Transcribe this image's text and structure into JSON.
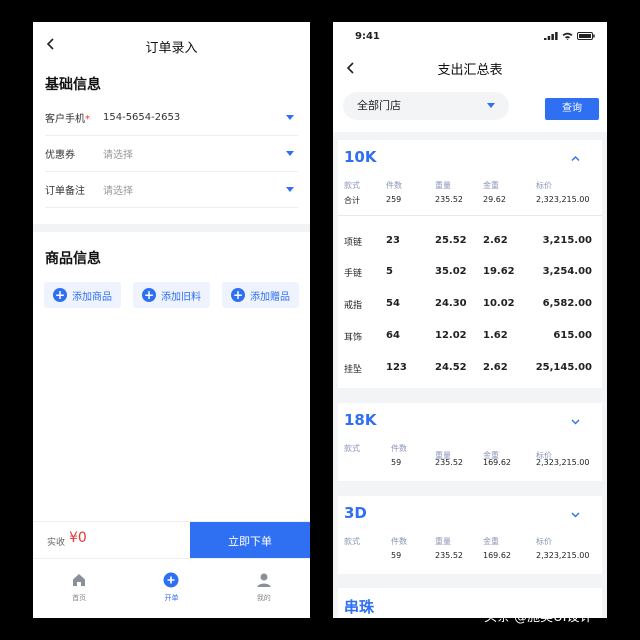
{
  "left": {
    "title": "订单录入",
    "basic_section": "基础信息",
    "phone_label": "客户手机",
    "required_mark": "*",
    "phone_value": "154-5654-2653",
    "coupon_label": "优惠券",
    "coupon_placeholder": "请选择",
    "remark_label": "订单备注",
    "remark_placeholder": "请选择",
    "goods_section": "商品信息",
    "add_goods": "添加商品",
    "add_old": "添加旧料",
    "add_gift": "添加赠品",
    "paid_label": "实收",
    "paid_value": "¥0",
    "order_button": "立即下单",
    "tabs": [
      {
        "label": "首页",
        "icon": "home-icon"
      },
      {
        "label": "开单",
        "icon": "plus-circle-icon"
      },
      {
        "label": "我的",
        "icon": "user-icon"
      }
    ],
    "accent": "#2f6ff2",
    "alert": "#e53935"
  },
  "right": {
    "time": "9:41",
    "title": "支出汇总表",
    "store_select": "全部门店",
    "query_button": "查询",
    "headers": [
      "款式",
      "件数",
      "重量",
      "金重",
      "标价"
    ],
    "total_label": "合计",
    "sections": [
      {
        "title": "10K",
        "expanded": true,
        "total": [
          "259",
          "235.52",
          "29.62",
          "2,323,215.00"
        ],
        "rows": [
          [
            "项链",
            "23",
            "25.52",
            "2.62",
            "3,215.00"
          ],
          [
            "手链",
            "5",
            "35.02",
            "19.62",
            "3,254.00"
          ],
          [
            "戒指",
            "54",
            "24.30",
            "10.02",
            "6,582.00"
          ],
          [
            "耳饰",
            "64",
            "12.02",
            "1.62",
            "615.00"
          ],
          [
            "挂坠",
            "123",
            "24.52",
            "2.62",
            "25,145.00"
          ]
        ]
      },
      {
        "title": "18K",
        "expanded": false,
        "total": [
          "59",
          "235.52",
          "169.62",
          "2,323,215.00"
        ]
      },
      {
        "title": "3D",
        "expanded": false,
        "total": [
          "59",
          "235.52",
          "169.62",
          "2,323,215.00"
        ]
      },
      {
        "title": "串珠"
      }
    ]
  },
  "watermark": "头条 @施昊UI设计"
}
